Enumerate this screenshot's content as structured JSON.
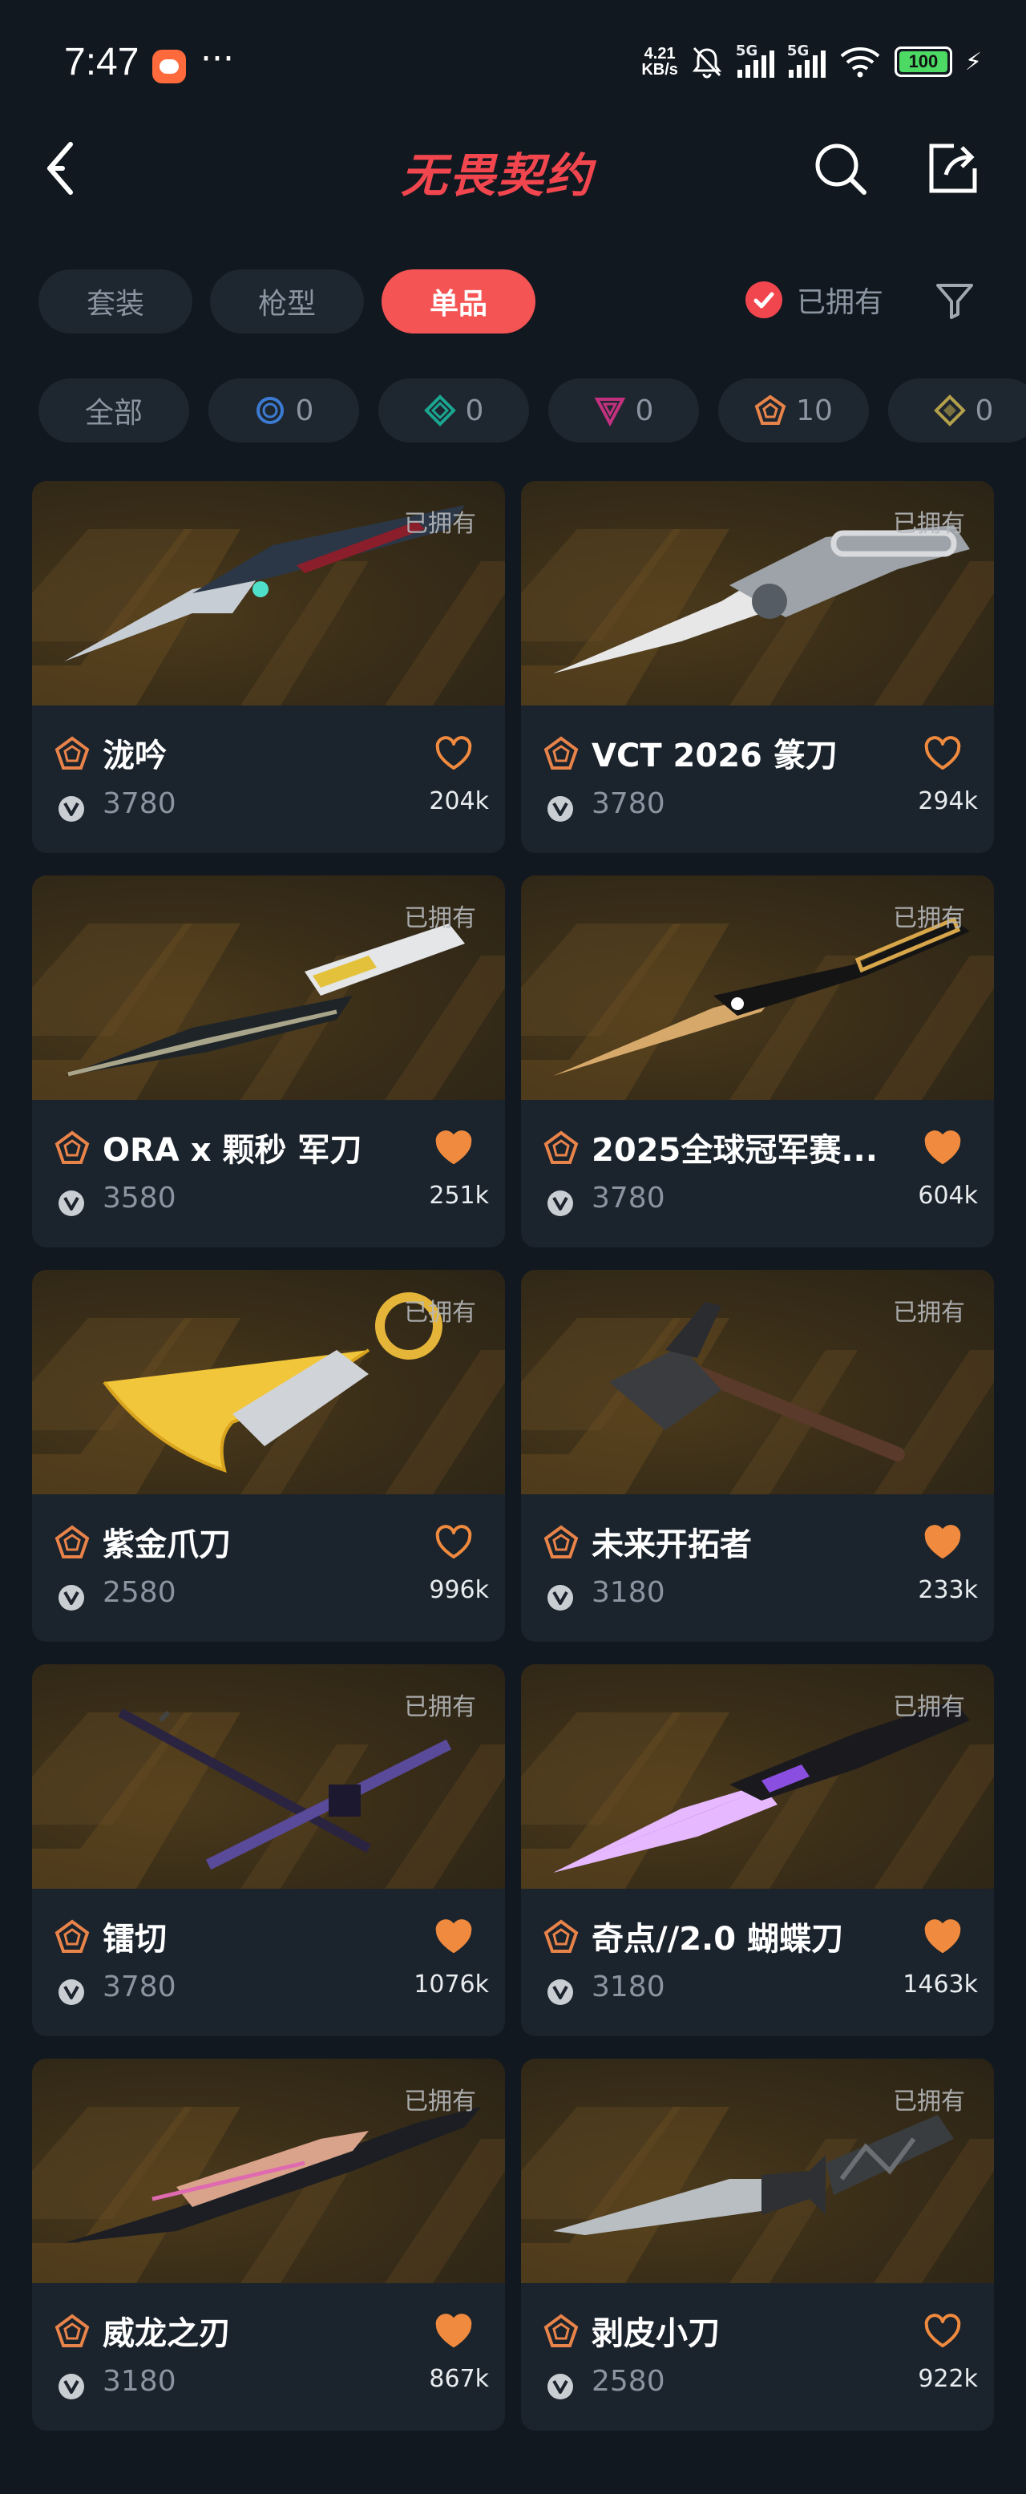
{
  "status_bar": {
    "time": "7:47",
    "dots": "···",
    "net_speed_value": "4.21",
    "net_speed_unit": "KB/s",
    "sim1": "5G",
    "sim2": "5G",
    "battery": "100"
  },
  "header": {
    "logo_text": "无畏契约"
  },
  "tabs": [
    {
      "label": "套装",
      "active": false
    },
    {
      "label": "枪型",
      "active": false
    },
    {
      "label": "单品",
      "active": true
    }
  ],
  "owned_filter": {
    "label": "已拥有",
    "checked": true
  },
  "rarity_chips": [
    {
      "label": "全部",
      "icon": "all"
    },
    {
      "label": "0",
      "icon": "select-tier-icon",
      "color": "#3c7bd1"
    },
    {
      "label": "0",
      "icon": "deluxe-tier-icon",
      "color": "#1aa691"
    },
    {
      "label": "0",
      "icon": "premium-tier-icon",
      "color": "#c2317f"
    },
    {
      "label": "10",
      "icon": "exclusive-tier-icon",
      "color": "#e8834a"
    },
    {
      "label": "0",
      "icon": "ultra-tier-icon",
      "color": "#b5a04a"
    }
  ],
  "cards": [
    {
      "name": "泷吟",
      "price": "3780",
      "likes": "204k",
      "liked": false,
      "owned_label": "已拥有"
    },
    {
      "name": "VCT 2026 篆刀",
      "price": "3780",
      "likes": "294k",
      "liked": false,
      "owned_label": "已拥有"
    },
    {
      "name": "ORA x 颗秒 军刀",
      "price": "3580",
      "likes": "251k",
      "liked": true,
      "owned_label": "已拥有"
    },
    {
      "name": "2025全球冠军赛...",
      "price": "3780",
      "likes": "604k",
      "liked": true,
      "owned_label": "已拥有"
    },
    {
      "name": "紫金爪刀",
      "price": "2580",
      "likes": "996k",
      "liked": false,
      "owned_label": "已拥有"
    },
    {
      "name": "未来开拓者",
      "price": "3180",
      "likes": "233k",
      "liked": true,
      "owned_label": "已拥有"
    },
    {
      "name": "镭切",
      "price": "3780",
      "likes": "1076k",
      "liked": true,
      "owned_label": "已拥有"
    },
    {
      "name": "奇点//2.0 蝴蝶刀",
      "price": "3180",
      "likes": "1463k",
      "liked": true,
      "owned_label": "已拥有"
    },
    {
      "name": "威龙之刃",
      "price": "3180",
      "likes": "867k",
      "liked": true,
      "owned_label": "已拥有"
    },
    {
      "name": "剥皮小刀",
      "price": "2580",
      "likes": "922k",
      "liked": false,
      "owned_label": "已拥有"
    }
  ],
  "colors": {
    "accent": "#f45454",
    "tier_exclusive": "#e8834a",
    "background": "#12181f",
    "card": "#1b232c"
  }
}
